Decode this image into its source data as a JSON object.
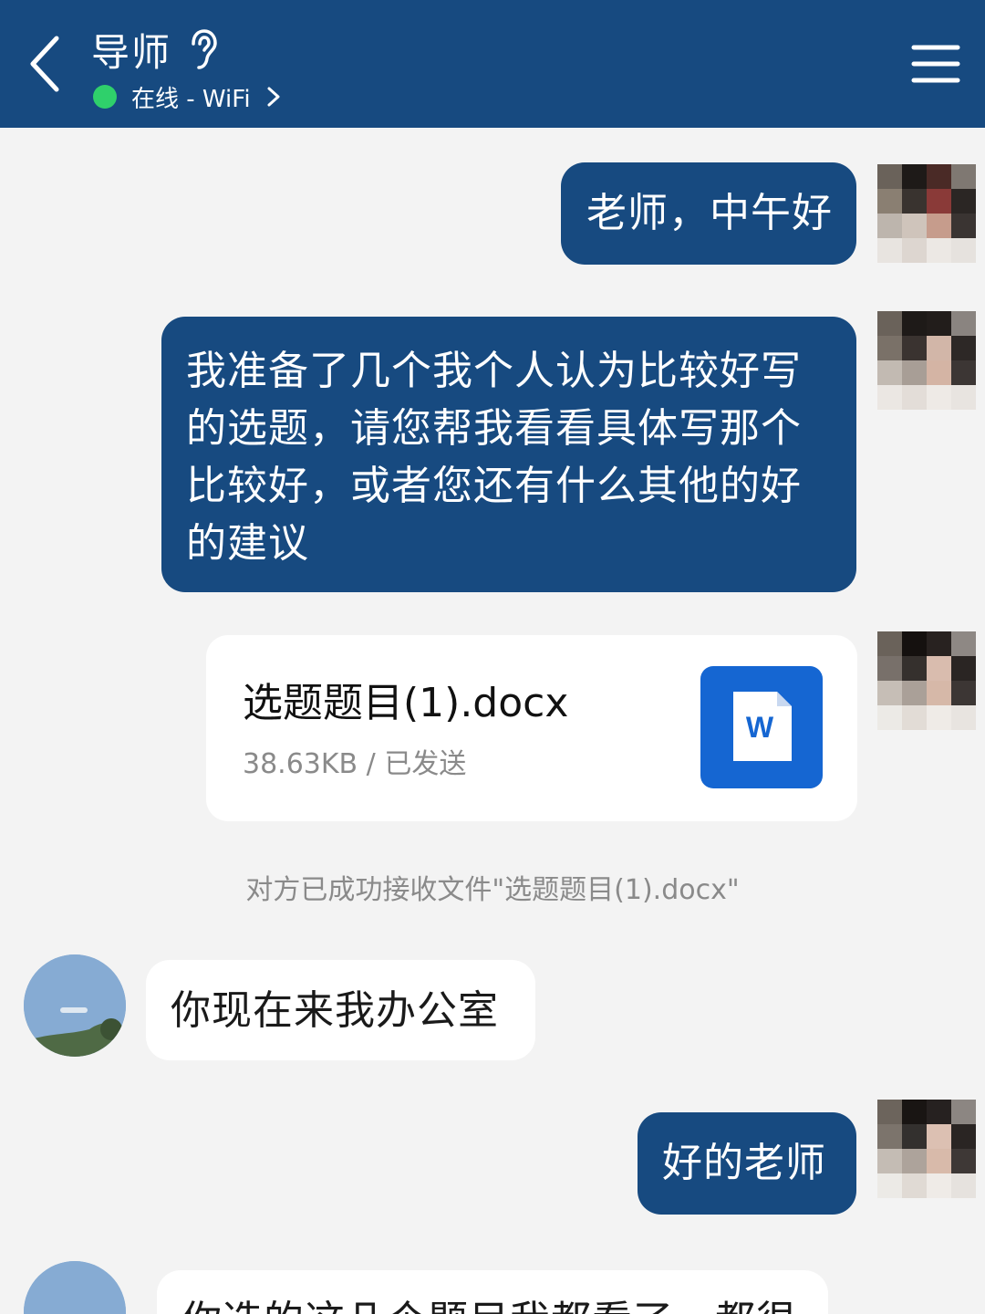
{
  "header": {
    "title": "导师",
    "status": "在线 - WiFi",
    "icons": {
      "back": "chevron-left-icon",
      "ear": "ear-icon",
      "status_arrow": "chevron-right-icon",
      "menu": "hamburger-menu-icon"
    },
    "colors": {
      "header_bg": "#174a80",
      "online": "#2fd06b"
    }
  },
  "messages": [
    {
      "side": "out",
      "text": "老师，中午好"
    },
    {
      "side": "out",
      "text": "我准备了几个我个人认为比较好写的选题，请您帮我看看具体写那个比较好，或者您还有什么其他的好的建议"
    },
    {
      "side": "out",
      "type": "file",
      "file_name": "选题题目(1).docx",
      "file_meta": "38.63KB / 已发送",
      "file_icon_letter": "W"
    },
    {
      "side": "system",
      "text": "对方已成功接收文件\"选题题目(1).docx\""
    },
    {
      "side": "in",
      "text": "你现在来我办公室"
    },
    {
      "side": "out",
      "text": "好的老师"
    },
    {
      "side": "in",
      "text": "你选的这几个题目我都看了，都很"
    }
  ]
}
